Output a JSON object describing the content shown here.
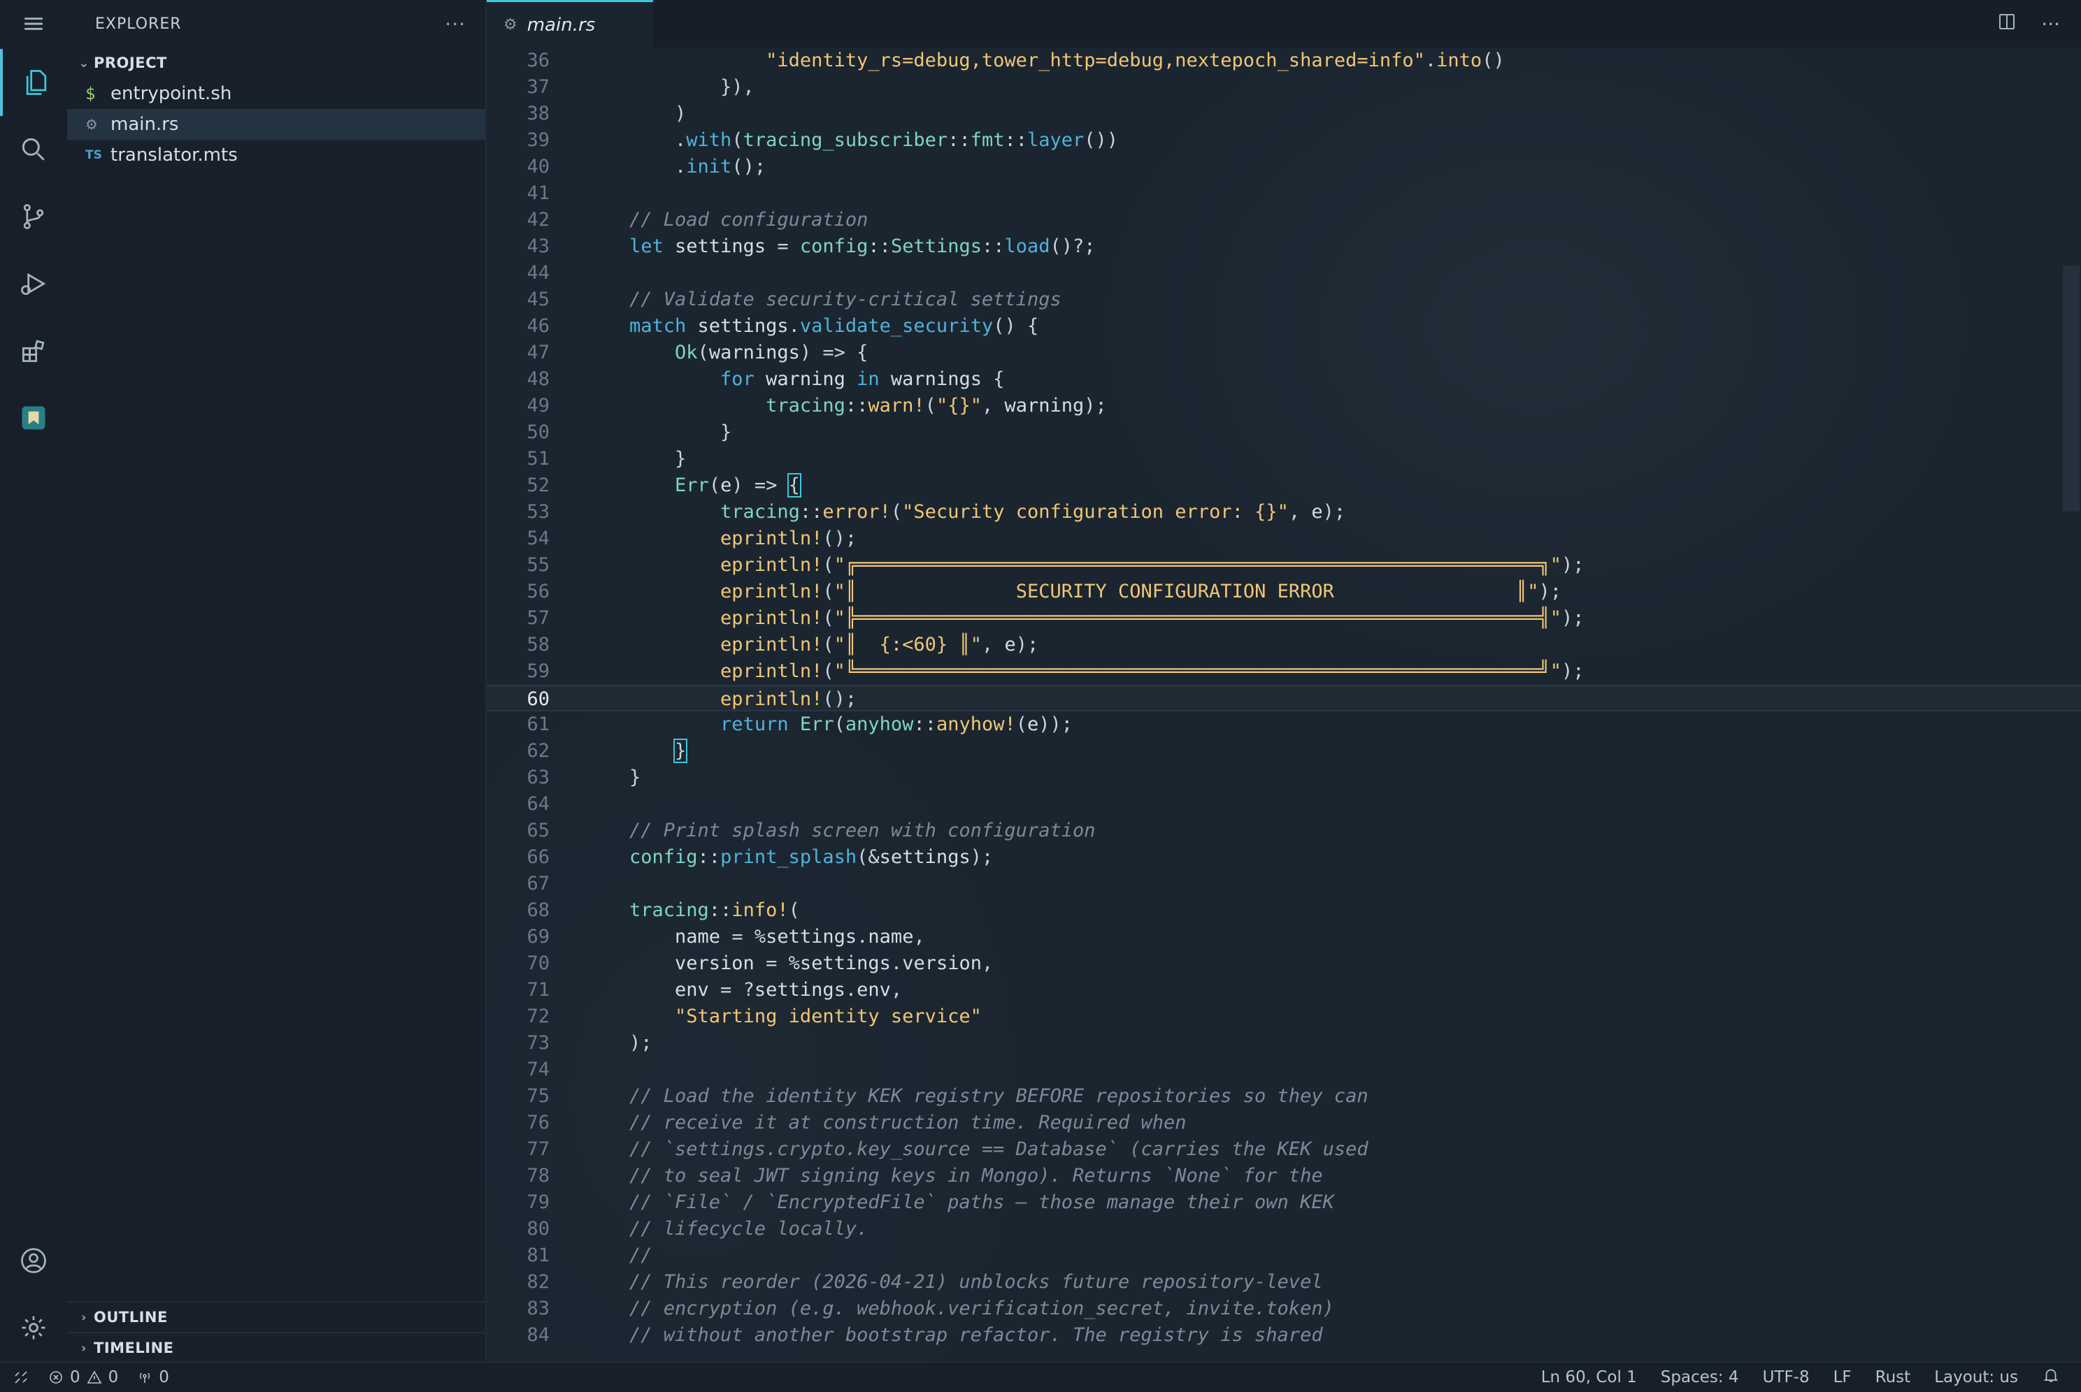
{
  "explorer": {
    "title": "EXPLORER",
    "more": "···",
    "project": "PROJECT",
    "files": [
      {
        "icon": "$",
        "name": "entrypoint.sh"
      },
      {
        "icon": "⚙",
        "name": "main.rs"
      },
      {
        "icon": "TS",
        "name": "translator.mts"
      }
    ],
    "outline": "OUTLINE",
    "timeline": "TIMELINE"
  },
  "tab": {
    "label": "main.rs",
    "icon": "⚙"
  },
  "editor": {
    "lines": [
      {
        "n": "36",
        "html": "<span class='str'>            \"identity_rs=debug,tower_http=debug,nextepoch_shared=info\"</span><span class='pu'>.</span><span class='fn'>into</span><span class='pu'>()</span>"
      },
      {
        "n": "37",
        "html": "<span class='pu'>        }),</span>"
      },
      {
        "n": "38",
        "html": "<span class='pu'>    )</span>"
      },
      {
        "n": "39",
        "html": "<span class='pu'>    .</span><span class='kw'>with</span><span class='pu'>(</span><span class='ty'>tracing_subscriber</span><span class='pu'>::</span><span class='ty'>fmt</span><span class='pu'>::</span><span class='kw'>layer</span><span class='pu'>())</span>"
      },
      {
        "n": "40",
        "html": "<span class='pu'>    .</span><span class='kw'>init</span><span class='pu'>();</span>"
      },
      {
        "n": "41",
        "html": ""
      },
      {
        "n": "42",
        "html": "<span class='cm'>// Load configuration</span>"
      },
      {
        "n": "43",
        "html": "<span class='kw'>let</span> settings <span class='pu'>=</span> <span class='ty'>config</span><span class='pu'>::</span><span class='ty'>Settings</span><span class='pu'>::</span><span class='kw'>load</span><span class='pu'>()?;</span>"
      },
      {
        "n": "44",
        "html": ""
      },
      {
        "n": "45",
        "html": "<span class='cm'>// Validate security-critical settings</span>"
      },
      {
        "n": "46",
        "html": "<span class='kw'>match</span> settings<span class='pu'>.</span><span class='kw'>validate_security</span><span class='pu'>() {</span>"
      },
      {
        "n": "47",
        "html": "    <span class='ty'>Ok</span><span class='pu'>(</span>warnings<span class='pu'>) =&gt; {</span>"
      },
      {
        "n": "48",
        "html": "        <span class='kw'>for</span> warning <span class='kw'>in</span> warnings <span class='pu'>{</span>"
      },
      {
        "n": "49",
        "html": "            <span class='ty'>tracing</span><span class='pu'>::</span><span class='fn'>warn!</span><span class='pu'>(</span><span class='str'>\"{}\"</span><span class='pu'>,</span> warning<span class='pu'>);</span>"
      },
      {
        "n": "50",
        "html": "        <span class='pu'>}</span>"
      },
      {
        "n": "51",
        "html": "    <span class='pu'>}</span>"
      },
      {
        "n": "52",
        "html": "    <span class='ty'>Err</span><span class='pu'>(</span>e<span class='pu'>) =&gt; </span><span class='pu br'>{</span>"
      },
      {
        "n": "53",
        "html": "        <span class='ty'>tracing</span><span class='pu'>::</span><span class='fn'>error!</span><span class='pu'>(</span><span class='str'>\"Security configuration error: {}\"</span><span class='pu'>,</span> e<span class='pu'>);</span>"
      },
      {
        "n": "54",
        "html": "        <span class='fn'>eprintln!</span><span class='pu'>();</span>"
      },
      {
        "n": "55",
        "html": "        <span class='fn'>eprintln!</span><span class='pu'>(</span><span class='str'>\"╔════════════════════════════════════════════════════════════╗\"</span><span class='pu'>);</span>"
      },
      {
        "n": "56",
        "html": "        <span class='fn'>eprintln!</span><span class='pu'>(</span><span class='str'>\"║              SECURITY CONFIGURATION ERROR                ║\"</span><span class='pu'>);</span>"
      },
      {
        "n": "57",
        "html": "        <span class='fn'>eprintln!</span><span class='pu'>(</span><span class='str'>\"╠════════════════════════════════════════════════════════════╣\"</span><span class='pu'>);</span>"
      },
      {
        "n": "58",
        "html": "        <span class='fn'>eprintln!</span><span class='pu'>(</span><span class='str'>\"║  {:&lt;60} ║\"</span><span class='pu'>,</span> e<span class='pu'>);</span>"
      },
      {
        "n": "59",
        "html": "        <span class='fn'>eprintln!</span><span class='pu'>(</span><span class='str'>\"╚════════════════════════════════════════════════════════════╝\"</span><span class='pu'>);</span>"
      },
      {
        "n": "60",
        "html": "        <span class='fn'>eprintln!</span><span class='pu'>();</span>",
        "current": true
      },
      {
        "n": "61",
        "html": "        <span class='kw'>return</span> <span class='ty'>Err</span><span class='pu'>(</span><span class='ty'>anyhow</span><span class='pu'>::</span><span class='fn'>anyhow!</span><span class='pu'>(</span>e<span class='pu'>));</span>"
      },
      {
        "n": "62",
        "html": "    <span class='pu br'>}</span>"
      },
      {
        "n": "63",
        "html": "<span class='pu'>}</span>"
      },
      {
        "n": "64",
        "html": ""
      },
      {
        "n": "65",
        "html": "<span class='cm'>// Print splash screen with configuration</span>"
      },
      {
        "n": "66",
        "html": "<span class='ty'>config</span><span class='pu'>::</span><span class='kw'>print_splash</span><span class='pu'>(&amp;</span>settings<span class='pu'>);</span>"
      },
      {
        "n": "67",
        "html": ""
      },
      {
        "n": "68",
        "html": "<span class='ty'>tracing</span><span class='pu'>::</span><span class='fn'>info!</span><span class='pu'>(</span>"
      },
      {
        "n": "69",
        "html": "    name <span class='pu'>=</span> <span class='pu'>%</span>settings<span class='pu'>.</span>name<span class='pu'>,</span>"
      },
      {
        "n": "70",
        "html": "    version <span class='pu'>=</span> <span class='pu'>%</span>settings<span class='pu'>.</span>version<span class='pu'>,</span>"
      },
      {
        "n": "71",
        "html": "    env <span class='pu'>=</span> <span class='pu'>?</span>settings<span class='pu'>.</span>env<span class='pu'>,</span>"
      },
      {
        "n": "72",
        "html": "    <span class='str'>\"Starting identity service\"</span>"
      },
      {
        "n": "73",
        "html": "<span class='pu'>);</span>"
      },
      {
        "n": "74",
        "html": ""
      },
      {
        "n": "75",
        "html": "<span class='cm'>// Load the identity KEK registry BEFORE repositories so they can</span>"
      },
      {
        "n": "76",
        "html": "<span class='cm'>// receive it at construction time. Required when</span>"
      },
      {
        "n": "77",
        "html": "<span class='cm'>// `settings.crypto.key_source == Database` (carries the KEK used</span>"
      },
      {
        "n": "78",
        "html": "<span class='cm'>// to seal JWT signing keys in Mongo). Returns `None` for the</span>"
      },
      {
        "n": "79",
        "html": "<span class='cm'>// `File` / `EncryptedFile` paths — those manage their own KEK</span>"
      },
      {
        "n": "80",
        "html": "<span class='cm'>// lifecycle locally.</span>"
      },
      {
        "n": "81",
        "html": "<span class='cm'>//</span>"
      },
      {
        "n": "82",
        "html": "<span class='cm'>// This reorder (2026-04-21) unblocks future repository-level</span>"
      },
      {
        "n": "83",
        "html": "<span class='cm'>// encryption (e.g. webhook.verification_secret, invite.token)</span>"
      },
      {
        "n": "84",
        "html": "<span class='cm'>// without another bootstrap refactor. The registry is shared</span>"
      }
    ]
  },
  "status": {
    "errors": "0",
    "warnings": "0",
    "ports": "0",
    "position": "Ln 60, Col 1",
    "spaces": "Spaces: 4",
    "encoding": "UTF-8",
    "eol": "LF",
    "language": "Rust",
    "layout": "Layout: us"
  }
}
